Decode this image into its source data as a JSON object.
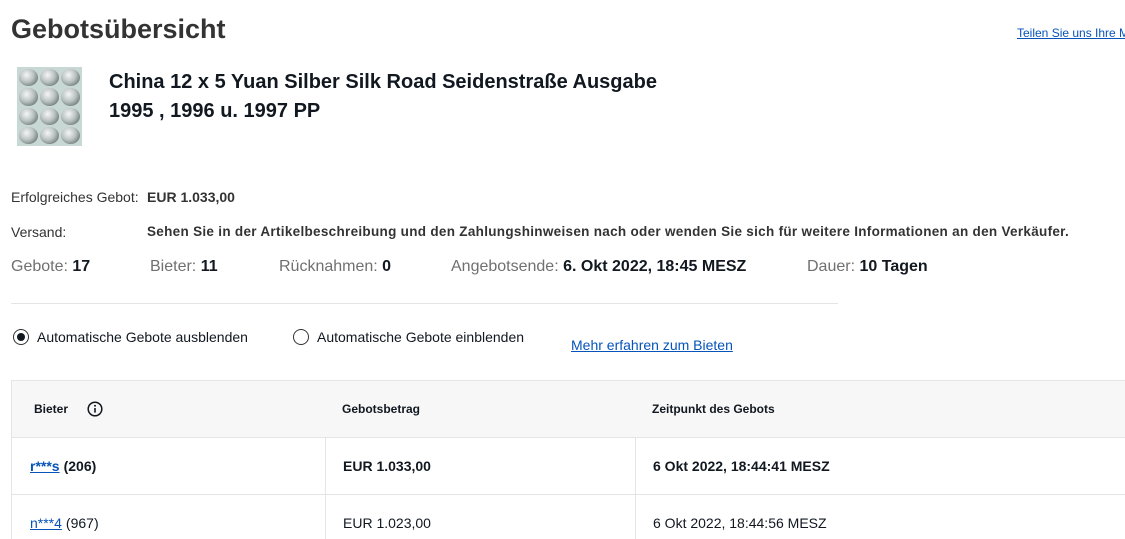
{
  "header": {
    "title": "Gebotsübersicht",
    "share_link": "Teilen Sie uns Ihre M"
  },
  "item": {
    "thumbnail_icon": "coin-set-photo",
    "title_line1": "China 12 x 5 Yuan Silber Silk Road Seidenstraße Ausgabe",
    "title_line2": "1995 , 1996 u. 1997 PP"
  },
  "summary": {
    "winning_bid_label": "Erfolgreiches Gebot:",
    "winning_bid_value": "EUR 1.033,00",
    "shipping_label": "Versand:",
    "shipping_value": "Sehen Sie in der Artikelbeschreibung und den Zahlungshinweisen nach oder wenden Sie sich für weitere Informationen an den Verkäufer."
  },
  "stats": {
    "bids_label": "Gebote:",
    "bids_value": "17",
    "bidders_label": "Bieter:",
    "bidders_value": "11",
    "retractions_label": "Rücknahmen:",
    "retractions_value": "0",
    "end_label": "Angebotsende:",
    "end_value": "6. Okt 2022, 18:45 MESZ",
    "duration_label": "Dauer:",
    "duration_value": "10 Tagen"
  },
  "options": {
    "hide_auto_label": "Automatische Gebote ausblenden",
    "hide_auto_selected": true,
    "show_auto_label": "Automatische Gebote einblenden",
    "show_auto_selected": false,
    "learn_more_link": "Mehr erfahren zum Bieten"
  },
  "table": {
    "columns": [
      "Bieter",
      "Gebotsbetrag",
      "Zeitpunkt des Gebots"
    ],
    "info_icon": "info-icon",
    "rows": [
      {
        "bidder": "r***s",
        "score": "(206)",
        "amount": "EUR 1.033,00",
        "time": "6 Okt 2022, 18:44:41 MESZ",
        "winner": true
      },
      {
        "bidder": "n***4",
        "score": "(967)",
        "amount": "EUR 1.023,00",
        "time": "6 Okt 2022, 18:44:56 MESZ",
        "winner": false
      }
    ]
  },
  "colors": {
    "link": "#0654ba",
    "text": "#111820",
    "muted": "#707070",
    "header_bg": "#f7f7f7"
  }
}
